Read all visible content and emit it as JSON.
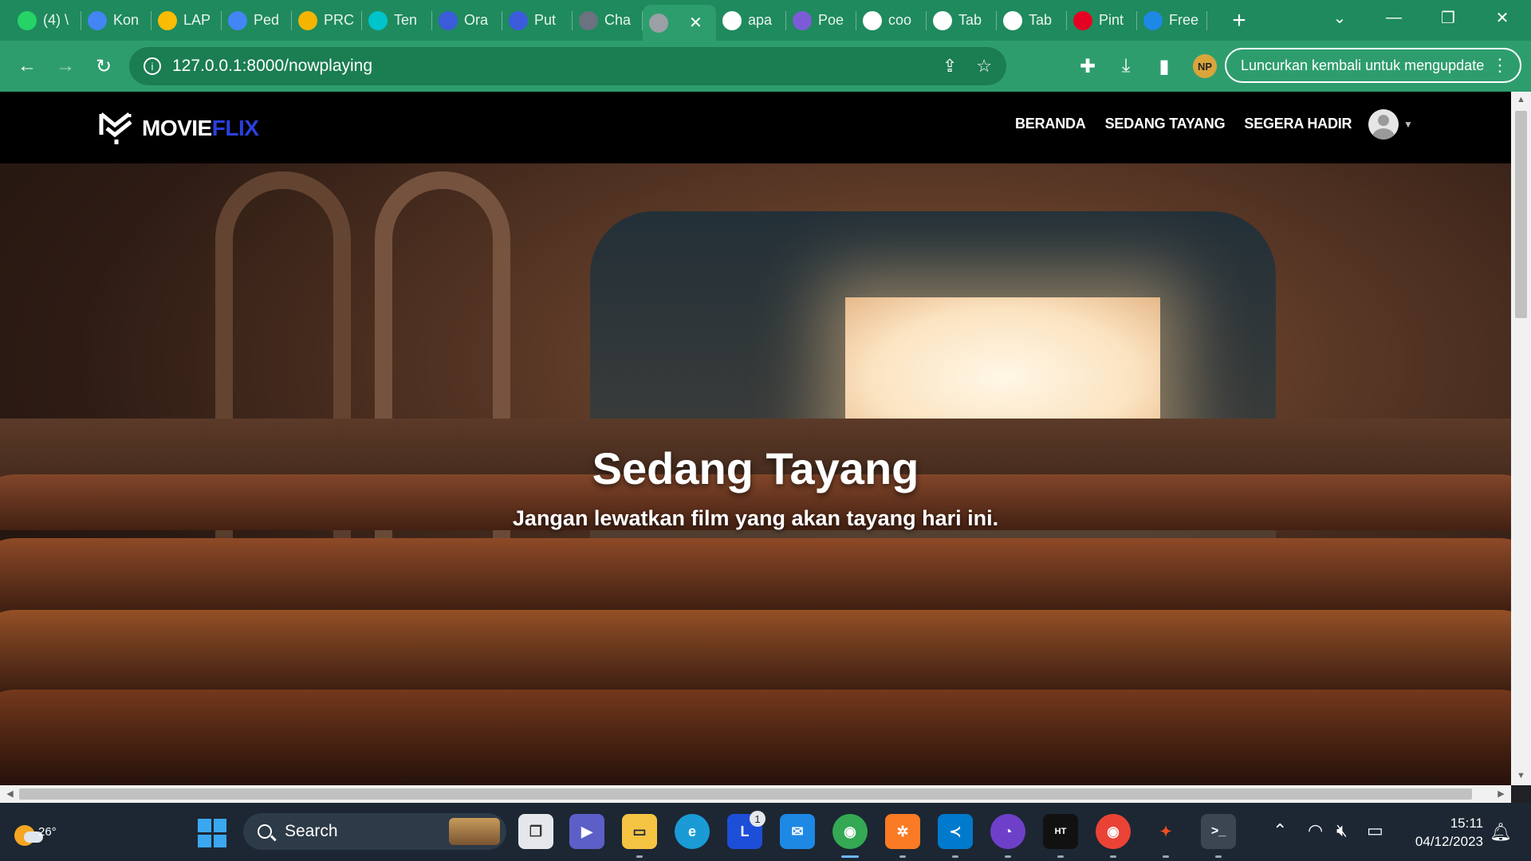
{
  "browser": {
    "tabs": [
      {
        "label": "(4) \\",
        "favicon": "whatsapp-icon",
        "color": "#25d366"
      },
      {
        "label": "Kon",
        "favicon": "docs-icon",
        "color": "#4285f4"
      },
      {
        "label": "LAP",
        "favicon": "drive-icon",
        "color": "#fbbc04"
      },
      {
        "label": "Ped",
        "favicon": "docs-icon",
        "color": "#4285f4"
      },
      {
        "label": "PRC",
        "favicon": "slides-icon",
        "color": "#f4b400"
      },
      {
        "label": "Ten",
        "favicon": "canva-icon",
        "color": "#00c4cc"
      },
      {
        "label": "Ora",
        "favicon": "heart-icon",
        "color": "#3b5bdb"
      },
      {
        "label": "Put",
        "favicon": "chat-icon",
        "color": "#3b5bdb"
      },
      {
        "label": "Cha",
        "favicon": "openai-icon",
        "color": "#6b7280"
      },
      {
        "label": "",
        "favicon": "globe-icon",
        "color": "#9aa0a6",
        "active": true
      },
      {
        "label": "apa",
        "favicon": "google-icon",
        "color": "#ffffff"
      },
      {
        "label": "Poe",
        "favicon": "poe-icon",
        "color": "#7c5cd6"
      },
      {
        "label": "coo",
        "favicon": "google-icon",
        "color": "#ffffff"
      },
      {
        "label": "Tab",
        "favicon": "chrome-icon",
        "color": "#ffffff"
      },
      {
        "label": "Tab",
        "favicon": "chrome-icon",
        "color": "#ffffff"
      },
      {
        "label": "Pint",
        "favicon": "pinterest-icon",
        "color": "#e60023"
      },
      {
        "label": "Free",
        "favicon": "tag-icon",
        "color": "#1e88e5"
      }
    ],
    "url": "127.0.0.1:8000/nowplaying",
    "update_button": "Luncurkan kembali untuk mengupdate",
    "accent": "#2e9d6e"
  },
  "site": {
    "logo_part1": "MOVIE",
    "logo_part2": "FLIX",
    "nav": [
      "BERANDA",
      "SEDANG TAYANG",
      "SEGERA HADIR"
    ],
    "hero_title": "Sedang Tayang",
    "hero_subtitle": "Jangan lewatkan film yang akan tayang hari ini."
  },
  "taskbar": {
    "temperature": "26°",
    "search_label": "Search",
    "time": "15:11",
    "date": "04/12/2023",
    "mail_badge": "1"
  }
}
